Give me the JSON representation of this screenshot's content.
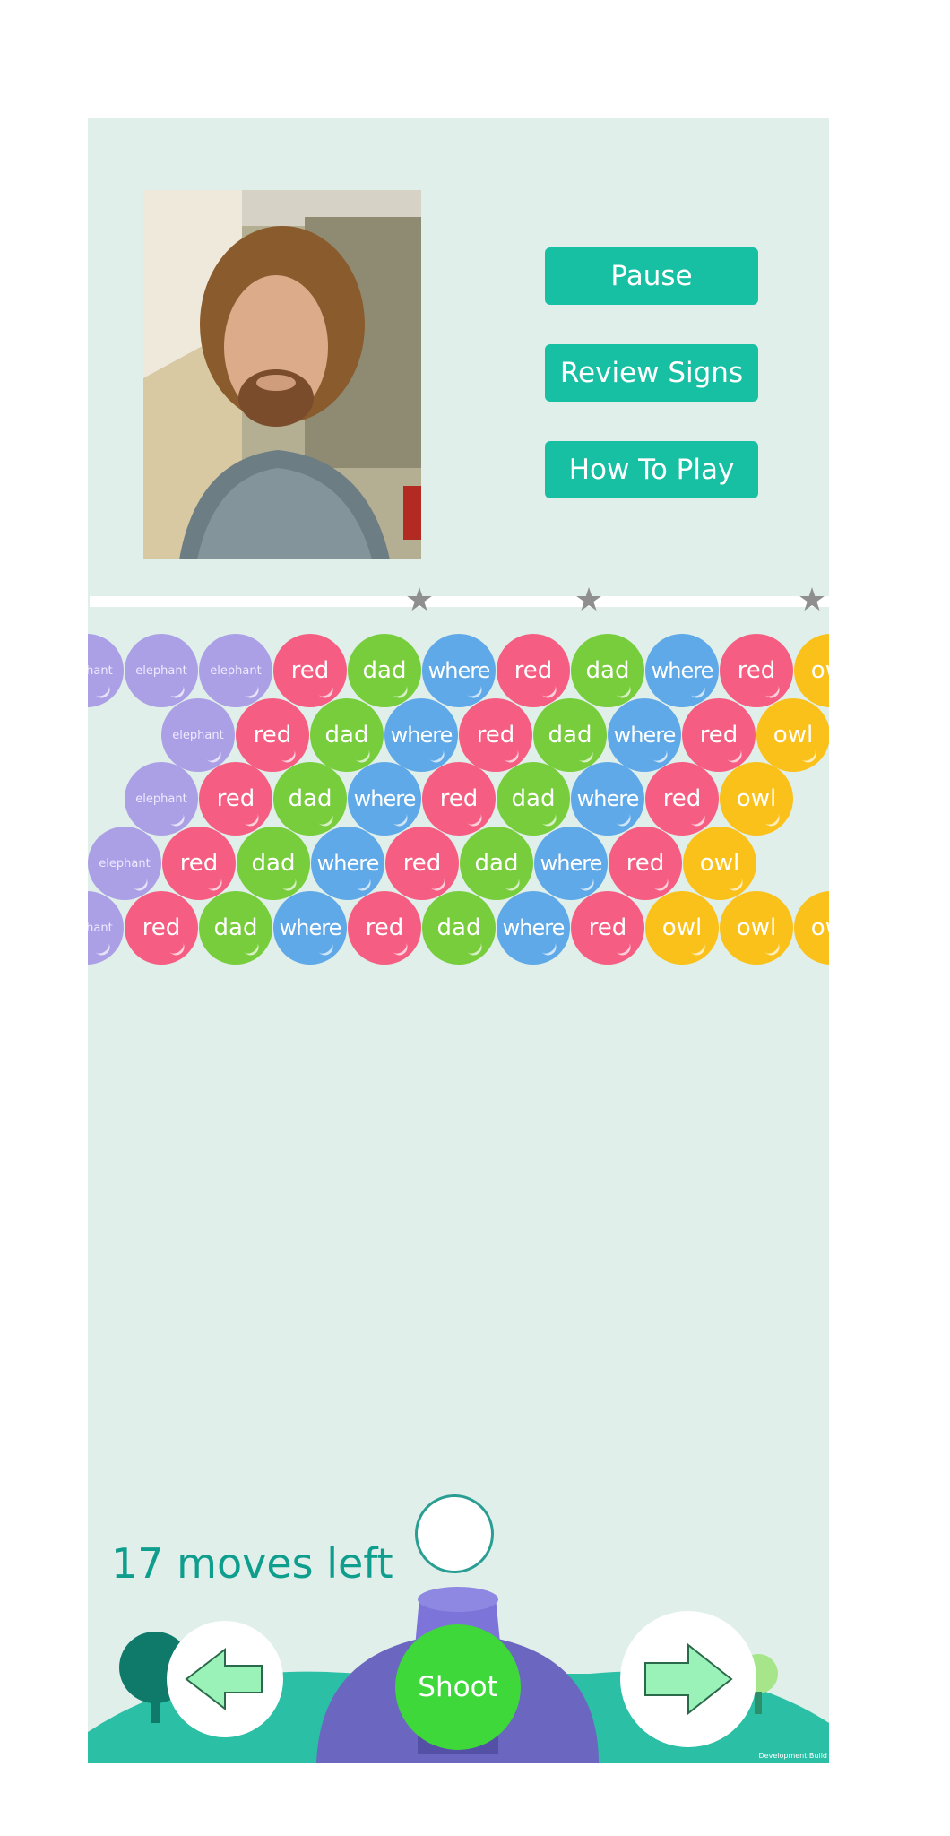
{
  "buttons": {
    "pause": "Pause",
    "review_signs": "Review Signs",
    "how_to_play": "How To Play",
    "shoot": "Shoot"
  },
  "status": {
    "moves_left": "17 moves left"
  },
  "progress": {
    "stars": 3
  },
  "footer": {
    "dev_label": "Development Build"
  },
  "colors": {
    "red": "#f55e82",
    "dad": "#77cd3b",
    "where": "#5fa9e8",
    "owl": "#fbc11b",
    "elephant": "#ab9fe6",
    "accent": "#17bfa3",
    "background": "#e0efea"
  },
  "bubble_rows": [
    [
      "elephant",
      "elephant",
      "elephant",
      "red",
      "dad",
      "where",
      "red",
      "dad",
      "where",
      "red",
      "owl"
    ],
    [
      "elephant",
      "red",
      "dad",
      "where",
      "red",
      "dad",
      "where",
      "red",
      "owl"
    ],
    [
      "elephant",
      "red",
      "dad",
      "where",
      "red",
      "dad",
      "where",
      "red",
      "owl"
    ],
    [
      "elephant",
      "red",
      "dad",
      "where",
      "red",
      "dad",
      "where",
      "red",
      "owl"
    ],
    [
      "elephant",
      "red",
      "dad",
      "where",
      "red",
      "dad",
      "where",
      "red",
      "owl",
      "owl",
      "owl"
    ]
  ],
  "icons": {
    "left": "left-arrow-icon",
    "right": "right-arrow-icon",
    "star": "star-icon"
  }
}
